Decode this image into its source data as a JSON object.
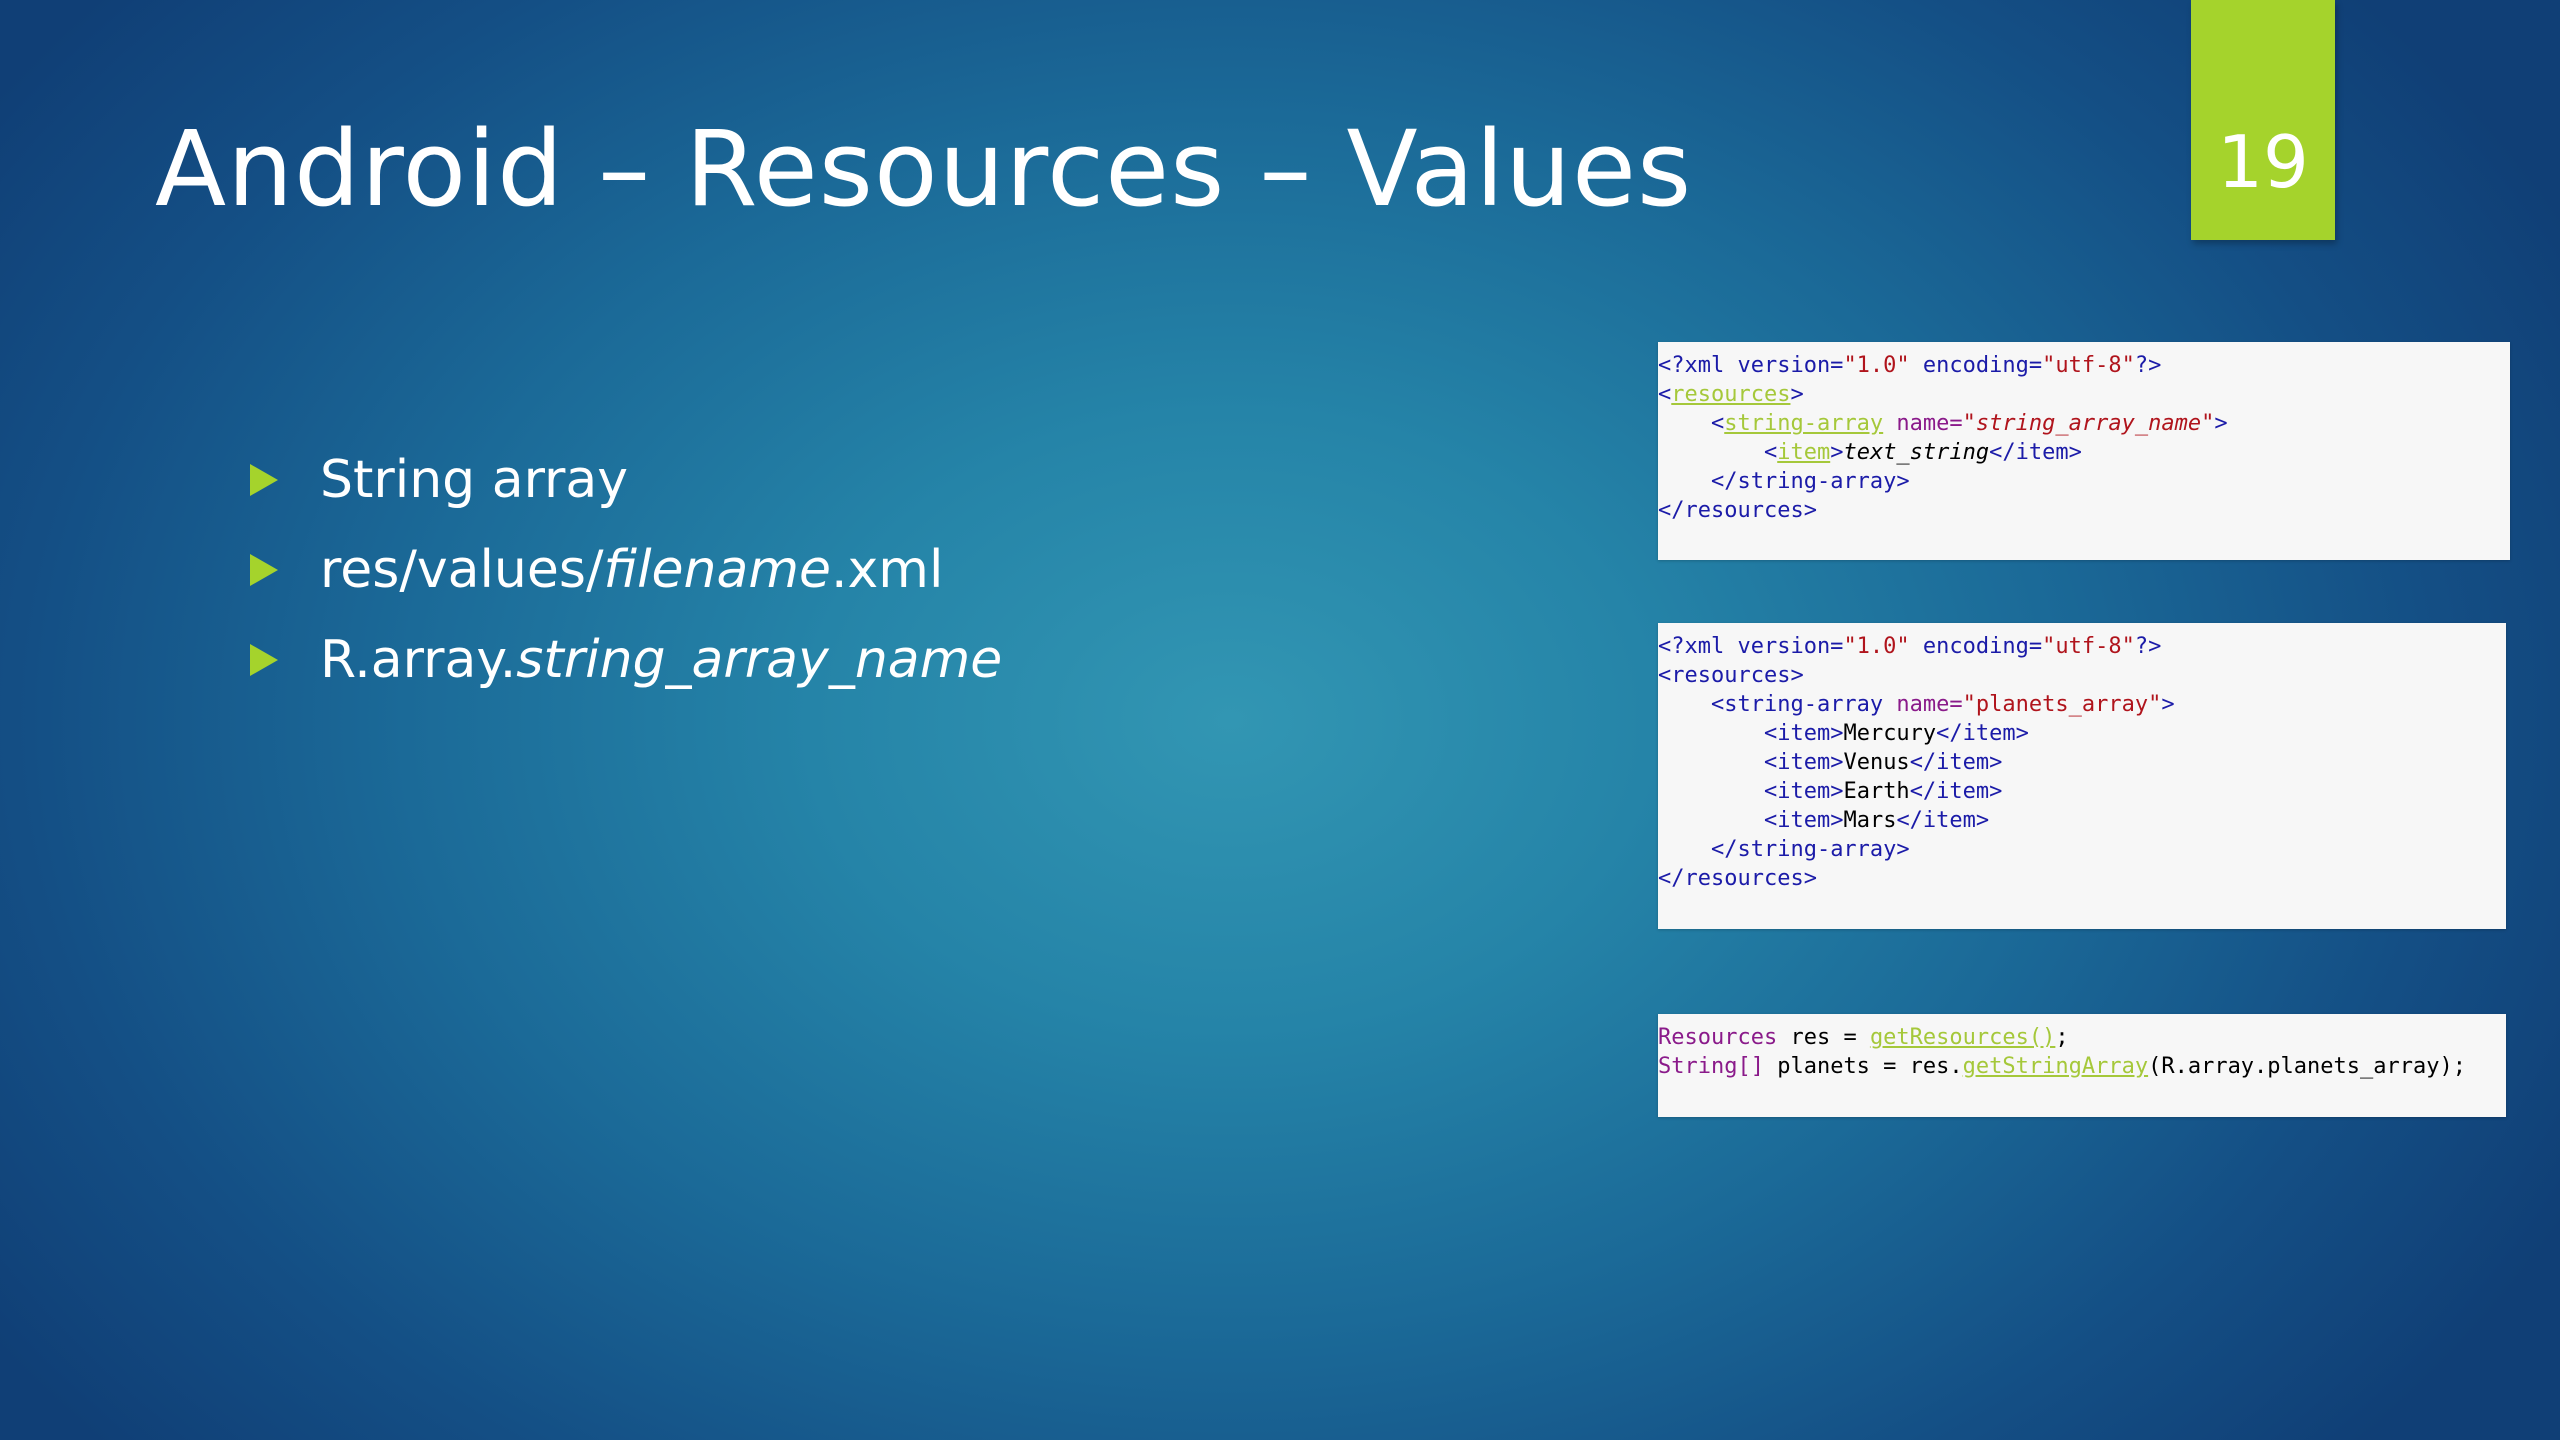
{
  "slide": {
    "title": "Android – Resources – Values",
    "number": "19"
  },
  "bullets": [
    {
      "prefix": "String array",
      "italic": "",
      "suffix": ""
    },
    {
      "prefix": "res/values/",
      "italic": "filename",
      "suffix": ".xml"
    },
    {
      "prefix": "R.array.",
      "italic": "string_array_name",
      "suffix": ""
    }
  ],
  "code": {
    "syntax": {
      "xml_decl_start": "<?xml version=",
      "version_val": "\"1.0\"",
      "encoding_attr": " encoding=",
      "encoding_val": "\"utf-8\"",
      "xml_decl_end": "?>",
      "lt": "<",
      "gt": ">",
      "resources_tag": "resources",
      "string_array_tag": "string-array",
      "name_attr": " name=",
      "item_tag": "item",
      "close_item": "</item>",
      "close_string_array": "</string-array>",
      "close_resources": "</resources>",
      "open_item": "<item>",
      "open_resources": "<resources>",
      "open_string_array": "<string-array"
    },
    "block1": {
      "name_val": "\"string_array_name\"",
      "item_text": "text_string"
    },
    "block2": {
      "name_val": "\"planets_array\"",
      "items": [
        "Mercury",
        "Venus",
        "Earth",
        "Mars"
      ]
    },
    "block3": {
      "resources_type": "Resources",
      "line1_mid": " res = ",
      "get_resources": "getResources()",
      "semicolon": ";",
      "string_type": "String[]",
      "line2_mid": " planets = res.",
      "get_string_array": "getStringArray",
      "args": "(R.array.planets_array)"
    }
  },
  "colors": {
    "accent": "#a5d32c",
    "background_center": "#3296b3",
    "background_edge": "#103f76"
  }
}
